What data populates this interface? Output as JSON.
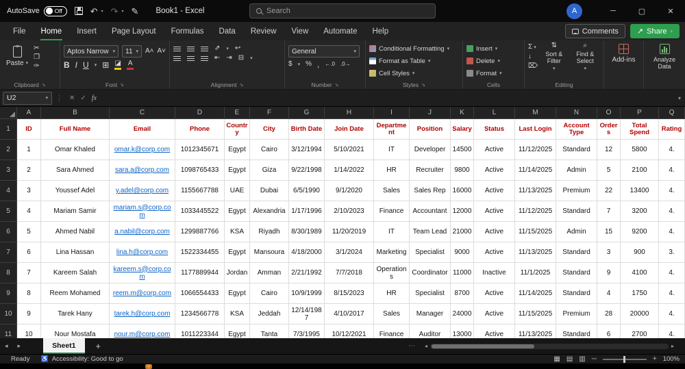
{
  "titlebar": {
    "autosave_label": "AutoSave",
    "autosave_state": "Off",
    "workbook_title": "Book1 - Excel",
    "search_placeholder": "Search",
    "avatar_initial": "A"
  },
  "ribbon_tabs": {
    "items": [
      "File",
      "Home",
      "Insert",
      "Page Layout",
      "Formulas",
      "Data",
      "Review",
      "View",
      "Automate",
      "Help"
    ],
    "active": "Home",
    "comments": "Comments",
    "share": "Share"
  },
  "ribbon": {
    "paste": "Paste",
    "clipboard_label": "Clipboard",
    "font_name": "Aptos Narrow",
    "font_size": "11",
    "font_label": "Font",
    "alignment_label": "Alignment",
    "number_format": "General",
    "number_label": "Number",
    "conditional_formatting": "Conditional Formatting",
    "format_as_table": "Format as Table",
    "cell_styles": "Cell Styles",
    "styles_label": "Styles",
    "insert": "Insert",
    "delete": "Delete",
    "format": "Format",
    "cells_label": "Cells",
    "sort_filter": "Sort & Filter",
    "find_select": "Find & Select",
    "editing_label": "Editing",
    "addins": "Add-ins",
    "analyze_data": "Analyze Data"
  },
  "icons": {
    "chevron": "▾",
    "scissors": "✂",
    "copy": "❐",
    "format_painter": "✑",
    "bold": "B",
    "italic": "I",
    "underline": "U",
    "borders": "⊞",
    "fill_shape": "◪",
    "font_color": "A",
    "undo": "↶",
    "redo": "↷",
    "pen": "✎",
    "sigma": "Σ",
    "dollar": "$",
    "percent": "%",
    "comma": ",",
    "inc_decimal": "←.0",
    "dec_decimal": ".0→",
    "orientation": "⇗",
    "wrap_text": "↩",
    "merge_center": "⊟",
    "indent_left": "⇤",
    "indent_right": "⇥",
    "sort_glyph": "⇅",
    "find_glyph": "⌕",
    "fill_down": "↓",
    "clear": "⌦",
    "grow_font": "A˄",
    "shrink_font": "A˅",
    "minimize": "─",
    "maximize": "▢",
    "close": "✕",
    "cancel": "✕",
    "enter": "✓",
    "fx": "fx",
    "dots_vertical": "⋮",
    "ellipsis": "⋯",
    "tab_prev": "◂",
    "tab_next": "▸",
    "add_sheet": "+",
    "share_arrow": "↗",
    "view_normal": "▦",
    "view_layout": "▤",
    "view_break": "▥",
    "zoom_out": "─",
    "zoom_in": "+",
    "accessibility": "♿"
  },
  "formula_bar": {
    "name_box": "U2"
  },
  "grid": {
    "column_letters": [
      "A",
      "B",
      "C",
      "D",
      "E",
      "F",
      "G",
      "H",
      "I",
      "J",
      "K",
      "L",
      "M",
      "N",
      "O",
      "P",
      "Q"
    ],
    "row_numbers": [
      "1",
      "2",
      "3",
      "4",
      "5",
      "6",
      "7",
      "8",
      "9",
      "10",
      "11"
    ],
    "header_row": [
      "ID",
      "Full Name",
      "Email",
      "Phone",
      "Country",
      "City",
      "Birth Date",
      "Join Date",
      "Department",
      "Position",
      "Salary",
      "Status",
      "Last Login",
      "Account Type",
      "Orders",
      "Total Spend",
      "Rating"
    ],
    "rows": [
      [
        "1",
        "Omar Khaled",
        "omar.k@corp.com",
        "1012345671",
        "Egypt",
        "Cairo",
        "3/12/1994",
        "5/10/2021",
        "IT",
        "Developer",
        "14500",
        "Active",
        "11/12/2025",
        "Standard",
        "12",
        "5800",
        "4."
      ],
      [
        "2",
        "Sara Ahmed",
        "sara.a@corp.com",
        "1098765433",
        "Egypt",
        "Giza",
        "9/22/1998",
        "1/14/2022",
        "HR",
        "Recruiter",
        "9800",
        "Active",
        "11/14/2025",
        "Admin",
        "5",
        "2100",
        "4."
      ],
      [
        "3",
        "Youssef Adel",
        "y.adel@corp.com",
        "1155667788",
        "UAE",
        "Dubai",
        "6/5/1990",
        "9/1/2020",
        "Sales",
        "Sales Rep",
        "16000",
        "Active",
        "11/13/2025",
        "Premium",
        "22",
        "13400",
        "4."
      ],
      [
        "4",
        "Mariam Samir",
        "mariam.s@corp.com",
        "1033445522",
        "Egypt",
        "Alexandria",
        "1/17/1996",
        "2/10/2023",
        "Finance",
        "Accountant",
        "12000",
        "Active",
        "11/12/2025",
        "Standard",
        "7",
        "3200",
        "4."
      ],
      [
        "5",
        "Ahmed Nabil",
        "a.nabil@corp.com",
        "1299887766",
        "KSA",
        "Riyadh",
        "8/30/1989",
        "11/20/2019",
        "IT",
        "Team Lead",
        "21000",
        "Active",
        "11/15/2025",
        "Admin",
        "15",
        "9200",
        "4."
      ],
      [
        "6",
        "Lina Hassan",
        "lina.h@corp.com",
        "1522334455",
        "Egypt",
        "Mansoura",
        "4/18/2000",
        "3/1/2024",
        "Marketing",
        "Specialist",
        "9000",
        "Active",
        "11/13/2025",
        "Standard",
        "3",
        "900",
        "3."
      ],
      [
        "7",
        "Kareem Salah",
        "kareem.s@corp.com",
        "1177889944",
        "Jordan",
        "Amman",
        "2/21/1992",
        "7/7/2018",
        "Operations",
        "Coordinator",
        "11000",
        "Inactive",
        "11/1/2025",
        "Standard",
        "9",
        "4100",
        "4."
      ],
      [
        "8",
        "Reem Mohamed",
        "reem.m@corp.com",
        "1066554433",
        "Egypt",
        "Cairo",
        "10/9/1999",
        "8/15/2023",
        "HR",
        "Specialist",
        "8700",
        "Active",
        "11/14/2025",
        "Standard",
        "4",
        "1750",
        "4."
      ],
      [
        "9",
        "Tarek Hany",
        "tarek.h@corp.com",
        "1234566778",
        "KSA",
        "Jeddah",
        "12/14/1987",
        "4/10/2017",
        "Sales",
        "Manager",
        "24000",
        "Active",
        "11/15/2025",
        "Premium",
        "28",
        "20000",
        "4."
      ],
      [
        "10",
        "Nour Mostafa",
        "nour.m@corp.com",
        "1011223344",
        "Egypt",
        "Tanta",
        "7/3/1995",
        "10/12/2021",
        "Finance",
        "Auditor",
        "13000",
        "Active",
        "11/13/2025",
        "Standard",
        "6",
        "2700",
        "4."
      ]
    ]
  },
  "sheet_bar": {
    "sheet_name": "Sheet1"
  },
  "status_bar": {
    "ready": "Ready",
    "accessibility": "Accessibility: Good to go",
    "zoom_level": "100%"
  }
}
